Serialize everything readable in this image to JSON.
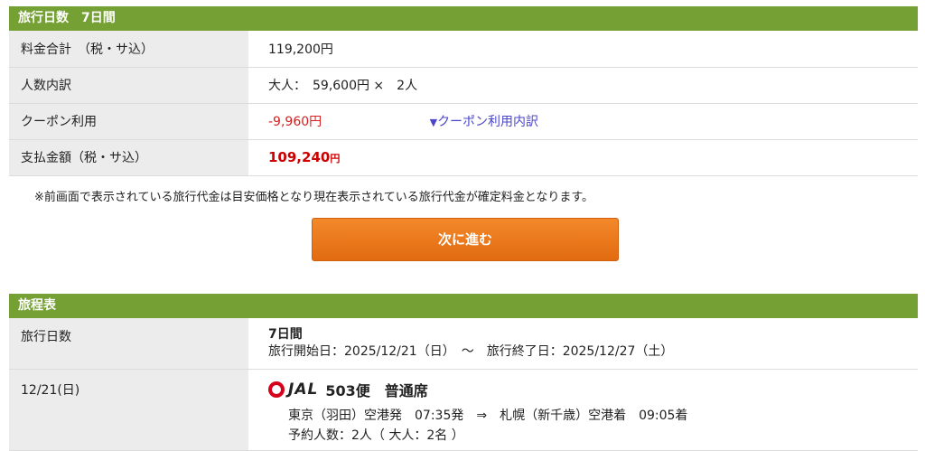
{
  "summary": {
    "header": "旅行日数　7日間",
    "rows": {
      "total_label": "料金合計　（税・サ込）",
      "total_value": "119,200円",
      "breakdown_label": "人数内訳",
      "breakdown_value": "大人：　59,600円 ×　2人",
      "coupon_label": "クーポン利用",
      "coupon_value": "-9,960円",
      "coupon_link": "クーポン利用内訳",
      "payment_label": "支払金額（税・サ込）",
      "payment_amount": "109,240",
      "payment_unit": "円"
    },
    "note": "※前画面で表示されている旅行代金は目安価格となり現在表示されている旅行代金が確定料金となります。"
  },
  "next_button": "次に進む",
  "itinerary": {
    "header": "旅程表",
    "days_label": "旅行日数",
    "days_value": "7日間",
    "dates": "旅行開始日：2025/12/21（日）　～　旅行終了日：2025/12/27（土）",
    "flight": {
      "date": "12/21(日)",
      "airline_logo_text": "JAL",
      "flight_name": "503便　普通席",
      "route": "東京（羽田）空港発　07:35発　⇒　札幌（新千歳）空港着　09:05着",
      "passengers": "予約人数：2人（ 大人：2名 ）"
    }
  },
  "colors": {
    "header_green": "#74a034",
    "button_orange": "#ec7a1c",
    "price_red": "#cc0000",
    "link_blue": "#4b46c8"
  }
}
